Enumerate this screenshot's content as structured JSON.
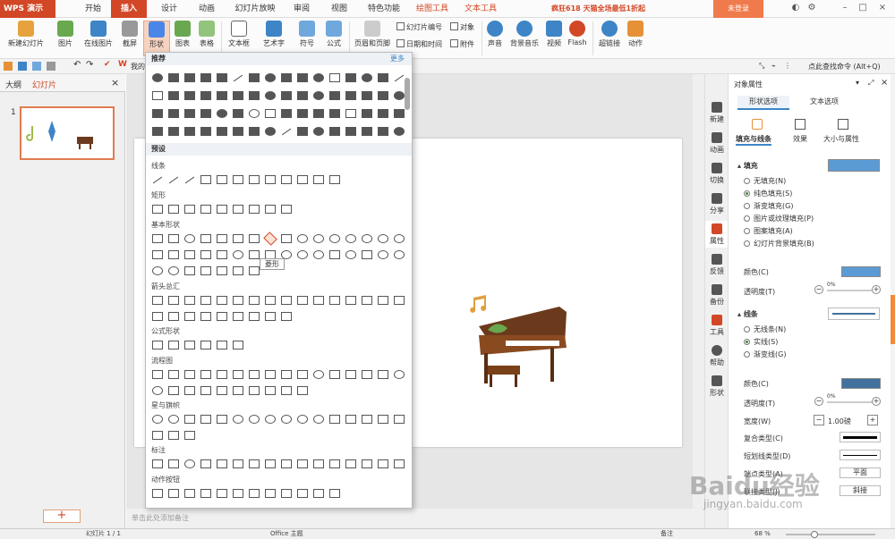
{
  "app": {
    "name": "WPS 演示"
  },
  "menu": {
    "tabs": [
      "开始",
      "插入",
      "设计",
      "动画",
      "幻灯片放映",
      "审阅",
      "视图",
      "特色功能",
      "绘图工具",
      "文本工具"
    ],
    "active": "插入"
  },
  "promo": "疯狂618 天猫全场最低1折起",
  "login": "未登录",
  "ribbon": {
    "new_slide": "新建幻灯片",
    "picture": "图片",
    "online_picture": "在线图片",
    "screenshot": "截屏",
    "shape": "形状",
    "chart": "图表",
    "table": "表格",
    "textbox": "文本框",
    "wordart": "艺术字",
    "symbol": "符号",
    "formula": "公式",
    "header_footer": "页眉和页脚",
    "slide_number": "幻灯片编号",
    "datetime": "日期和时间",
    "object": "对象",
    "attachment": "附件",
    "audio": "声音",
    "bg_music": "背景音乐",
    "video": "视频",
    "flash": "Flash",
    "hyperlink": "超链接",
    "action": "动作"
  },
  "quickbar": {
    "mine": "我的",
    "search": "点此查找命令 (Alt+Q)"
  },
  "left_panel": {
    "outline_tab": "大纲",
    "slides_tab": "幻灯片",
    "slide_num": "1",
    "add": "+"
  },
  "notes": "单击此处添加备注",
  "shapes": {
    "recommended": "推荐",
    "more": "更多",
    "preset": "预设",
    "sections": [
      "线条",
      "矩形",
      "基本形状",
      "箭头总汇",
      "公式形状",
      "流程图",
      "星与旗帜",
      "标注",
      "动作按钮"
    ],
    "tooltip": "菱形"
  },
  "right_strip": [
    "新建",
    "动画",
    "切换",
    "分享",
    "属性",
    "反馈",
    "备份",
    "工具",
    "帮助",
    "形状"
  ],
  "props": {
    "title": "对象属性",
    "tab_shape": "形状选项",
    "tab_text": "文本选项",
    "sub_fill_line": "填充与线条",
    "sub_effect": "效果",
    "sub_size": "大小与属性",
    "fill": "填充",
    "fill_options": [
      "无填充(N)",
      "纯色填充(S)",
      "渐变填充(G)",
      "图片或纹理填充(P)",
      "图案填充(A)",
      "幻灯片背景填充(B)"
    ],
    "fill_selected": 1,
    "color": "颜色(C)",
    "transparency": "透明度(T)",
    "trans_value": "0%",
    "line": "线条",
    "line_options": [
      "无线条(N)",
      "实线(S)",
      "渐变线(G)"
    ],
    "line_selected": 1,
    "line_color": "颜色(C)",
    "line_trans": "透明度(T)",
    "line_trans_value": "0%",
    "width": "宽度(W)",
    "width_value": "1.00磅",
    "minus": "−",
    "plus": "+",
    "compound": "复合类型(C)",
    "dash": "短划线类型(D)",
    "cap": "端点类型(A)",
    "cap_value": "平面",
    "join": "联接类型(J)",
    "join_value": "斜接",
    "fill_color": "#5b9bd5",
    "line_color_hex": "#41719c"
  },
  "status": {
    "slide": "幻灯片 1 / 1",
    "theme": "Office 主题",
    "notes": "备注",
    "zoom": "68 %"
  },
  "watermark": "Baidu经验",
  "watermark_url": "jingyan.baidu.com"
}
